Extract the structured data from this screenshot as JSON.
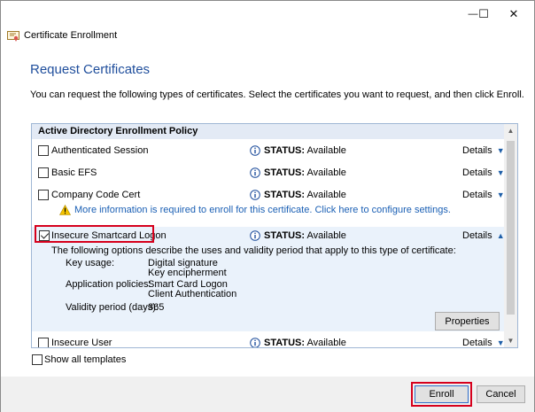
{
  "window": {
    "minimize_glyph": "—",
    "maximize_glyph": "☐",
    "close_glyph": "✕"
  },
  "header": {
    "wizard_title": "Certificate Enrollment",
    "page_title": "Request Certificates",
    "intro": "You can request the following types of certificates. Select the certificates you want to request, and then click Enroll."
  },
  "policy_group": {
    "title": "Active Directory Enrollment Policy"
  },
  "status_label": "STATUS:",
  "details_label": "Details",
  "certificates": [
    {
      "name": "Authenticated Session",
      "status": "Available",
      "checked": false
    },
    {
      "name": "Basic EFS",
      "status": "Available",
      "checked": false
    },
    {
      "name": "Company Code Cert",
      "status": "Available",
      "checked": false,
      "warning": "More information is required to enroll for this certificate. Click here to configure settings."
    },
    {
      "name": "Insecure Smartcard Logon",
      "status": "Available",
      "checked": true
    },
    {
      "name": "Insecure User",
      "status": "Available",
      "checked": false
    }
  ],
  "expanded": {
    "description": "The following options describe the uses and validity period that apply to this type of certificate:",
    "key_usage_label": "Key usage:",
    "key_usage_values": [
      "Digital signature",
      "Key encipherment"
    ],
    "app_policies_label": "Application policies:",
    "app_policies_values": [
      "Smart Card Logon",
      "Client Authentication"
    ],
    "validity_label": "Validity period (days):",
    "validity_value": "365",
    "properties_button": "Properties"
  },
  "show_all_templates": "Show all templates",
  "buttons": {
    "enroll": "Enroll",
    "cancel": "Cancel"
  },
  "colors": {
    "accent_title": "#1f4e9c",
    "link": "#1a5fb4",
    "highlight_box": "#d6001c",
    "selected_row": "#eaf2fb",
    "group_header": "#e3eaf5"
  },
  "icons": {
    "wizard": "certificate-icon",
    "status": "info-icon",
    "warning": "warning-icon"
  }
}
